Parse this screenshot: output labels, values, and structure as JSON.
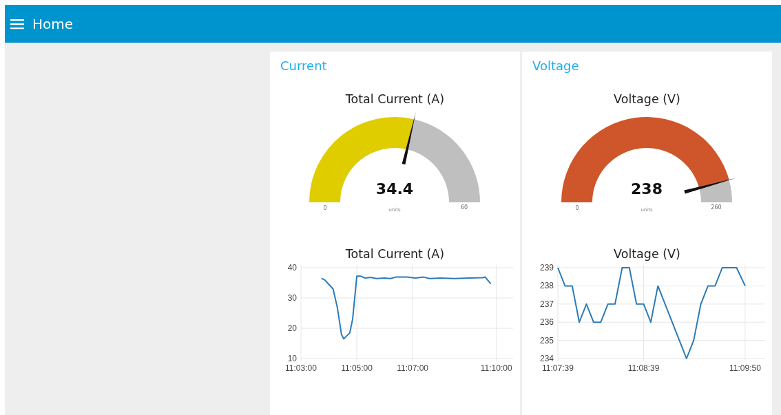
{
  "header": {
    "title": "Home"
  },
  "groups": [
    {
      "title": "Current",
      "gauge": {
        "title": "Total Current (A)",
        "value": "34.4",
        "units": "units",
        "min": "0",
        "max": "60",
        "color": "#dfcd00"
      },
      "chart_data": {
        "type": "line",
        "title": "Total Current (A)",
        "x": [
          39824,
          39831,
          39840,
          39849,
          39858,
          39867,
          39872,
          39885,
          39891,
          39900,
          39909,
          39918,
          39930,
          39942,
          39960,
          39972,
          39984,
          40008,
          40026,
          40044,
          40056,
          40080,
          40110,
          40140,
          40170,
          40176,
          40188
        ],
        "series": [
          {
            "color": "#2b7bb9",
            "values": [
              36.5,
              36,
              34.5,
              33,
              27,
              18,
              16.5,
              18.5,
              23,
              37.2,
              37.2,
              36.6,
              36.8,
              36.4,
              36.6,
              36.4,
              36.9,
              36.9,
              36.6,
              36.9,
              36.4,
              36.6,
              36.4,
              36.6,
              36.7,
              36.9,
              34.7
            ]
          }
        ],
        "xlim": [
          39780,
          40236
        ],
        "ylim": [
          10,
          40
        ],
        "xticks": [
          {
            "value": 39780,
            "label": "11:03:00"
          },
          {
            "value": 39900,
            "label": "11:05:00"
          },
          {
            "value": 40020,
            "label": "11:07:00"
          },
          {
            "value": 40200,
            "label": "11:10:00"
          }
        ],
        "yticks": [
          10,
          20,
          30,
          40
        ],
        "grid": true
      }
    },
    {
      "title": "Voltage",
      "gauge": {
        "title": "Voltage (V)",
        "value": "238",
        "units": "units",
        "min": "0",
        "max": "260",
        "color": "#cf562b"
      },
      "chart_data": {
        "type": "line",
        "title": "Voltage (V)",
        "x": [
          40059,
          40064,
          40069,
          40074,
          40079,
          40084,
          40089,
          40094,
          40099,
          40104,
          40109,
          40114,
          40119,
          40124,
          40129,
          40149,
          40154,
          40159,
          40164,
          40169,
          40174,
          40184,
          40190
        ],
        "series": [
          {
            "color": "#2b7bb9",
            "values": [
              239,
              238,
              238,
              236,
              237,
              236,
              236,
              237,
              237,
              239,
              239,
              237,
              237,
              236,
              238,
              234,
              235,
              237,
              238,
              238,
              239,
              239,
              238
            ]
          }
        ],
        "xlim": [
          40059,
          40204
        ],
        "ylim": [
          234,
          239
        ],
        "xticks": [
          {
            "value": 40059,
            "label": "11:07:39"
          },
          {
            "value": 40119,
            "label": "11:08:39"
          },
          {
            "value": 40190,
            "label": "11:09:50"
          }
        ],
        "yticks": [
          234,
          235,
          236,
          237,
          238,
          239
        ],
        "grid": true
      }
    }
  ]
}
